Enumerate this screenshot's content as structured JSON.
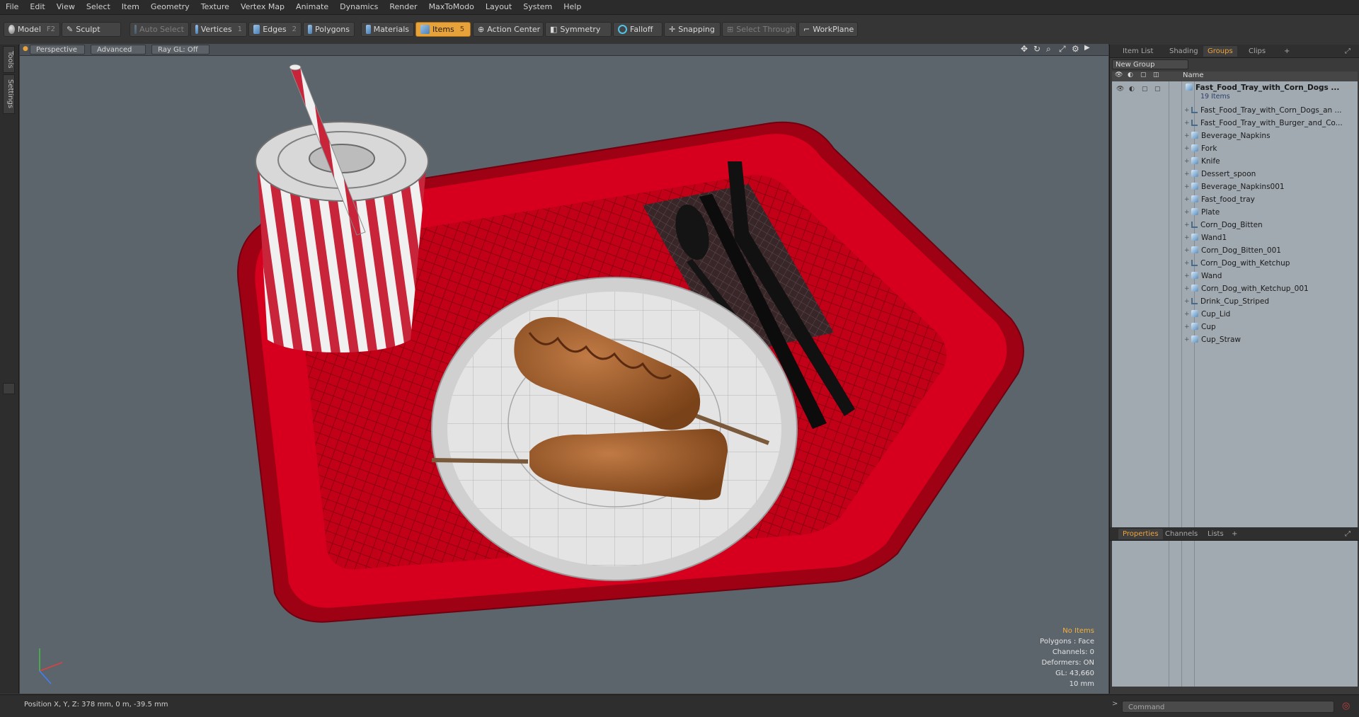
{
  "menu": [
    "File",
    "Edit",
    "View",
    "Select",
    "Item",
    "Geometry",
    "Texture",
    "Vertex Map",
    "Animate",
    "Dynamics",
    "Render",
    "MaxToModo",
    "Layout",
    "System",
    "Help"
  ],
  "toolbar": {
    "model": "Model",
    "model_key": "F2",
    "sculpt": "Sculpt",
    "auto_select": "Auto Select",
    "vertices": "Vertices",
    "vertices_key": "1",
    "edges": "Edges",
    "edges_key": "2",
    "polygons": "Polygons",
    "materials": "Materials",
    "items": "Items",
    "items_key": "5",
    "action_center": "Action Center",
    "symmetry": "Symmetry",
    "falloff": "Falloff",
    "snapping": "Snapping",
    "select_through": "Select Through",
    "workplane": "WorkPlane",
    "accent": "#e8a23a"
  },
  "left_tabs": [
    "Tools",
    "Settings"
  ],
  "viewport": {
    "view": "Perspective",
    "shading": "Advanced",
    "raygl": "Ray GL: Off",
    "info": {
      "items": "No Items",
      "polygons": "Polygons : Face",
      "channels": "Channels: 0",
      "deformers": "Deformers: ON",
      "gl": "GL: 43,660",
      "unit": "10 mm"
    },
    "background": "#5c656c",
    "tray_color": "#c8001a"
  },
  "status": {
    "position": "Position X, Y, Z:  378 mm, 0 m, -39.5 mm"
  },
  "panel": {
    "tabs": [
      "Item List",
      "Shading",
      "Groups",
      "Clips"
    ],
    "active_tab": "Groups",
    "new_group": "New Group",
    "name_col": "Name",
    "group": {
      "name": "Fast_Food_Tray_with_Corn_Dogs ...",
      "count": "19 Items"
    },
    "items": [
      {
        "name": "Fast_Food_Tray_with_Corn_Dogs_an ...",
        "icon": "locator-icon"
      },
      {
        "name": "Fast_Food_Tray_with_Burger_and_Co...",
        "icon": "locator-icon"
      },
      {
        "name": "Beverage_Napkins",
        "icon": "mesh-icon"
      },
      {
        "name": "Fork",
        "icon": "mesh-icon"
      },
      {
        "name": "Knife",
        "icon": "mesh-icon"
      },
      {
        "name": "Dessert_spoon",
        "icon": "mesh-icon"
      },
      {
        "name": "Beverage_Napkins001",
        "icon": "mesh-icon"
      },
      {
        "name": "Fast_food_tray",
        "icon": "mesh-icon"
      },
      {
        "name": "Plate",
        "icon": "mesh-icon"
      },
      {
        "name": "Corn_Dog_Bitten",
        "icon": "locator-icon"
      },
      {
        "name": "Wand1",
        "icon": "mesh-icon"
      },
      {
        "name": "Corn_Dog_Bitten_001",
        "icon": "mesh-icon"
      },
      {
        "name": "Corn_Dog_with_Ketchup",
        "icon": "locator-icon"
      },
      {
        "name": "Wand",
        "icon": "mesh-icon"
      },
      {
        "name": "Corn_Dog_with_Ketchup_001",
        "icon": "mesh-icon"
      },
      {
        "name": "Drink_Cup_Striped",
        "icon": "locator-icon"
      },
      {
        "name": "Cup_Lid",
        "icon": "mesh-icon"
      },
      {
        "name": "Cup",
        "icon": "mesh-icon"
      },
      {
        "name": "Cup_Straw",
        "icon": "mesh-icon"
      }
    ],
    "bottom_tabs": [
      "Properties",
      "Channels",
      "Lists"
    ],
    "bottom_active": "Properties",
    "command_placeholder": "Command"
  }
}
